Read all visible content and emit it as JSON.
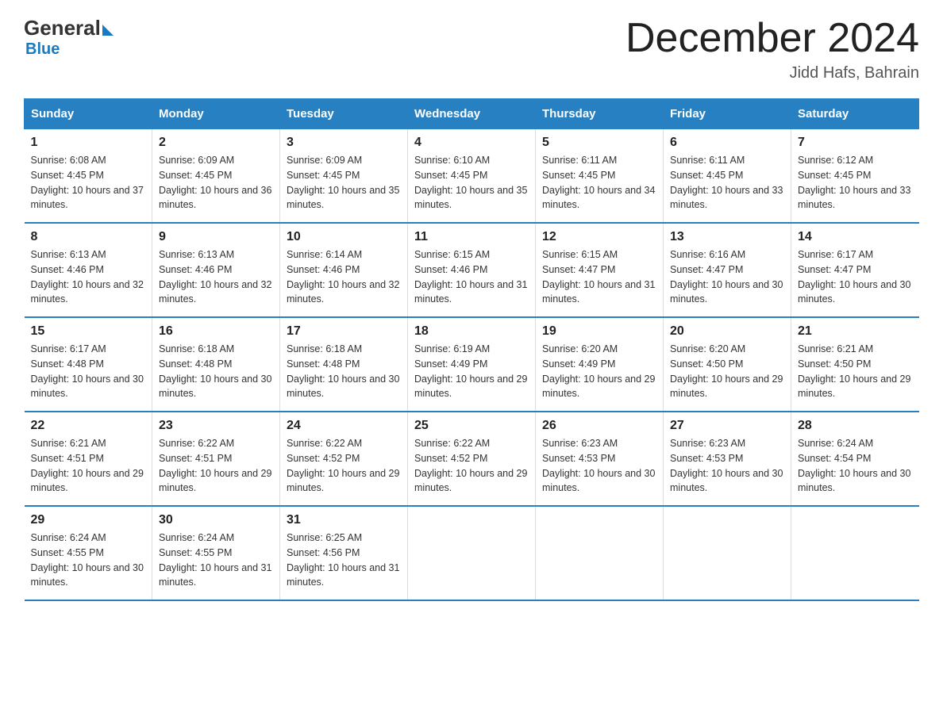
{
  "header": {
    "logo_general": "General",
    "logo_blue": "Blue",
    "month_title": "December 2024",
    "location": "Jidd Hafs, Bahrain"
  },
  "weekdays": [
    "Sunday",
    "Monday",
    "Tuesday",
    "Wednesday",
    "Thursday",
    "Friday",
    "Saturday"
  ],
  "weeks": [
    [
      {
        "day": "1",
        "sunrise": "6:08 AM",
        "sunset": "4:45 PM",
        "daylight": "10 hours and 37 minutes."
      },
      {
        "day": "2",
        "sunrise": "6:09 AM",
        "sunset": "4:45 PM",
        "daylight": "10 hours and 36 minutes."
      },
      {
        "day": "3",
        "sunrise": "6:09 AM",
        "sunset": "4:45 PM",
        "daylight": "10 hours and 35 minutes."
      },
      {
        "day": "4",
        "sunrise": "6:10 AM",
        "sunset": "4:45 PM",
        "daylight": "10 hours and 35 minutes."
      },
      {
        "day": "5",
        "sunrise": "6:11 AM",
        "sunset": "4:45 PM",
        "daylight": "10 hours and 34 minutes."
      },
      {
        "day": "6",
        "sunrise": "6:11 AM",
        "sunset": "4:45 PM",
        "daylight": "10 hours and 33 minutes."
      },
      {
        "day": "7",
        "sunrise": "6:12 AM",
        "sunset": "4:45 PM",
        "daylight": "10 hours and 33 minutes."
      }
    ],
    [
      {
        "day": "8",
        "sunrise": "6:13 AM",
        "sunset": "4:46 PM",
        "daylight": "10 hours and 32 minutes."
      },
      {
        "day": "9",
        "sunrise": "6:13 AM",
        "sunset": "4:46 PM",
        "daylight": "10 hours and 32 minutes."
      },
      {
        "day": "10",
        "sunrise": "6:14 AM",
        "sunset": "4:46 PM",
        "daylight": "10 hours and 32 minutes."
      },
      {
        "day": "11",
        "sunrise": "6:15 AM",
        "sunset": "4:46 PM",
        "daylight": "10 hours and 31 minutes."
      },
      {
        "day": "12",
        "sunrise": "6:15 AM",
        "sunset": "4:47 PM",
        "daylight": "10 hours and 31 minutes."
      },
      {
        "day": "13",
        "sunrise": "6:16 AM",
        "sunset": "4:47 PM",
        "daylight": "10 hours and 30 minutes."
      },
      {
        "day": "14",
        "sunrise": "6:17 AM",
        "sunset": "4:47 PM",
        "daylight": "10 hours and 30 minutes."
      }
    ],
    [
      {
        "day": "15",
        "sunrise": "6:17 AM",
        "sunset": "4:48 PM",
        "daylight": "10 hours and 30 minutes."
      },
      {
        "day": "16",
        "sunrise": "6:18 AM",
        "sunset": "4:48 PM",
        "daylight": "10 hours and 30 minutes."
      },
      {
        "day": "17",
        "sunrise": "6:18 AM",
        "sunset": "4:48 PM",
        "daylight": "10 hours and 30 minutes."
      },
      {
        "day": "18",
        "sunrise": "6:19 AM",
        "sunset": "4:49 PM",
        "daylight": "10 hours and 29 minutes."
      },
      {
        "day": "19",
        "sunrise": "6:20 AM",
        "sunset": "4:49 PM",
        "daylight": "10 hours and 29 minutes."
      },
      {
        "day": "20",
        "sunrise": "6:20 AM",
        "sunset": "4:50 PM",
        "daylight": "10 hours and 29 minutes."
      },
      {
        "day": "21",
        "sunrise": "6:21 AM",
        "sunset": "4:50 PM",
        "daylight": "10 hours and 29 minutes."
      }
    ],
    [
      {
        "day": "22",
        "sunrise": "6:21 AM",
        "sunset": "4:51 PM",
        "daylight": "10 hours and 29 minutes."
      },
      {
        "day": "23",
        "sunrise": "6:22 AM",
        "sunset": "4:51 PM",
        "daylight": "10 hours and 29 minutes."
      },
      {
        "day": "24",
        "sunrise": "6:22 AM",
        "sunset": "4:52 PM",
        "daylight": "10 hours and 29 minutes."
      },
      {
        "day": "25",
        "sunrise": "6:22 AM",
        "sunset": "4:52 PM",
        "daylight": "10 hours and 29 minutes."
      },
      {
        "day": "26",
        "sunrise": "6:23 AM",
        "sunset": "4:53 PM",
        "daylight": "10 hours and 30 minutes."
      },
      {
        "day": "27",
        "sunrise": "6:23 AM",
        "sunset": "4:53 PM",
        "daylight": "10 hours and 30 minutes."
      },
      {
        "day": "28",
        "sunrise": "6:24 AM",
        "sunset": "4:54 PM",
        "daylight": "10 hours and 30 minutes."
      }
    ],
    [
      {
        "day": "29",
        "sunrise": "6:24 AM",
        "sunset": "4:55 PM",
        "daylight": "10 hours and 30 minutes."
      },
      {
        "day": "30",
        "sunrise": "6:24 AM",
        "sunset": "4:55 PM",
        "daylight": "10 hours and 31 minutes."
      },
      {
        "day": "31",
        "sunrise": "6:25 AM",
        "sunset": "4:56 PM",
        "daylight": "10 hours and 31 minutes."
      },
      null,
      null,
      null,
      null
    ]
  ]
}
